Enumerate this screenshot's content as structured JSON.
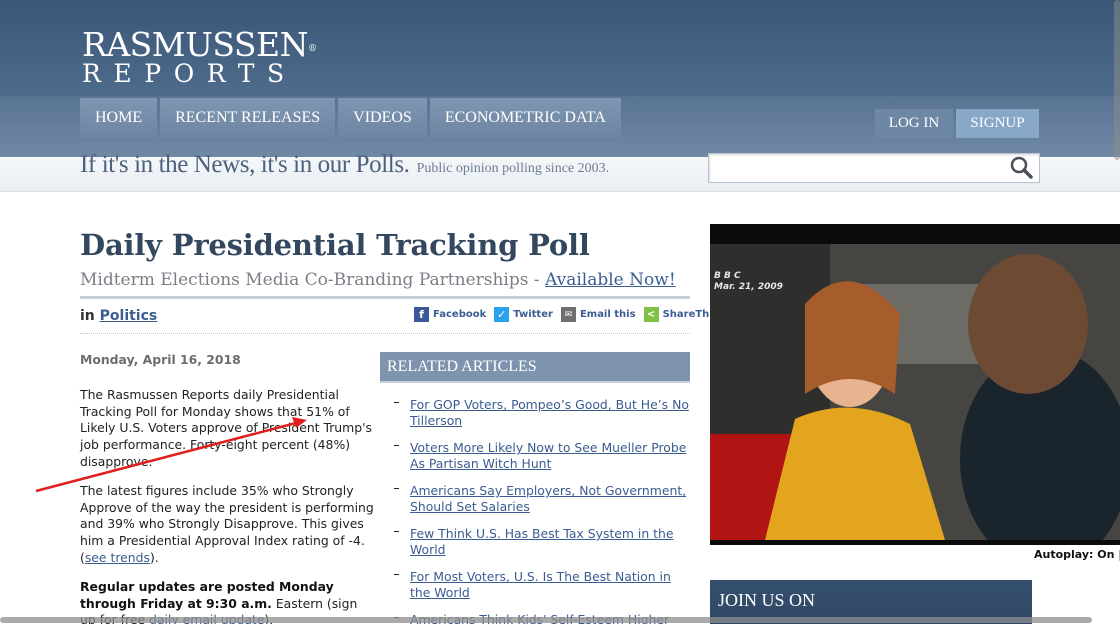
{
  "brand": {
    "name_top": "RASMUSSEN",
    "name_bottom": "REPORTS",
    "registered": "®"
  },
  "nav": {
    "items": [
      "HOME",
      "RECENT RELEASES",
      "VIDEOS",
      "ECONOMETRIC DATA"
    ]
  },
  "auth": {
    "login": "LOG IN",
    "signup": "SIGNUP"
  },
  "tagline": {
    "main": "If it's in the News, it's in our Polls.",
    "sub": "Public opinion polling since 2003."
  },
  "search": {
    "placeholder": "",
    "icon": "search-icon"
  },
  "article": {
    "title": "Daily Presidential Tracking Poll",
    "subtitle": "Midterm Elections Media Co-Branding Partnerships - ",
    "subtitle_link": "Available Now!",
    "category_prefix": "in",
    "category": "Politics",
    "date": "Monday, April 16, 2018",
    "para1": "The Rasmussen Reports daily Presidential Tracking Poll for Monday shows that 51% of Likely U.S. Voters approve of President Trump's job performance. Forty-eight percent (48%) disapprove.",
    "para2": "The latest figures include 35% who Strongly Approve of the way the president is performing and 39% who Strongly Disapprove. This gives him a Presidential Approval Index rating of -4. (",
    "para2_link": "see trends",
    "para2_end": ").",
    "para3_bold": "Regular updates are posted Monday through Friday at 9:30 a.m.",
    "para3": " Eastern (sign up for free ",
    "para3_link": "daily email update",
    "para3_end": ")."
  },
  "share": {
    "facebook": "Facebook",
    "twitter": "Twitter",
    "email": "Email this",
    "sharethis": "ShareThis"
  },
  "related": {
    "heading": "RELATED ARTICLES",
    "items": [
      "For GOP Voters, Pompeo’s Good, But He’s No Tillerson",
      "Voters More Likely Now to See Mueller Probe As Partisan Witch Hunt",
      "Americans Say Employers, Not Government, Should Set Salaries",
      "Few Think U.S. Has Best Tax System in the World",
      "For Most Voters, U.S. Is The Best Nation in the World",
      "Americans Think Kids' Self-Esteem Higher Than Actual Achievement"
    ]
  },
  "video": {
    "network": "B B C",
    "date": "Mar. 21, 2009"
  },
  "autoplay": "Autoplay: On |",
  "join": "JOIN US ON",
  "colors": {
    "header": "#3b5677",
    "nav": "#7f96b1",
    "link": "#3b5c91",
    "annotation_arrow": "#e01e1e"
  }
}
